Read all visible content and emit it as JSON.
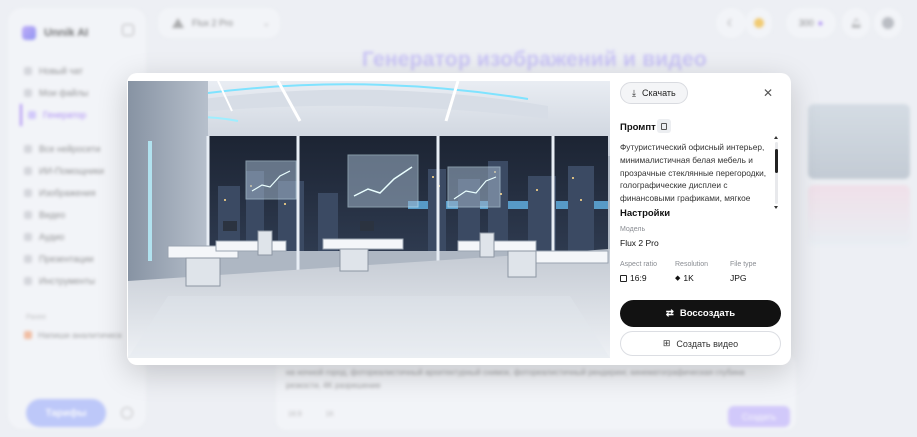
{
  "app": {
    "brand": "Unnik AI",
    "model_pill": "Flux 2 Pro",
    "credits": "300",
    "page_title": "Генератор изображений и видео"
  },
  "sidebar": {
    "items": [
      {
        "label": "Новый чат"
      },
      {
        "label": "Мои файлы"
      },
      {
        "label": "Генератор"
      },
      {
        "label": "Все нейросети"
      },
      {
        "label": "ИИ-Помощники"
      },
      {
        "label": "Изображения"
      },
      {
        "label": "Видео"
      },
      {
        "label": "Аудио"
      },
      {
        "label": "Презентации"
      },
      {
        "label": "Инструменты"
      }
    ],
    "recent_heading": "Ранее",
    "recent_item": "Напиши аналитическ",
    "tariff_button": "Тарифы"
  },
  "background_prompt": {
    "text": "на ночной город, фотореалистичный архитектурный снимок, фотореалистичный рендеринг, кинематографическая глубина резкости, 4K разрешение",
    "chip1": "16:9",
    "chip2": "1К",
    "create_button": "Создать"
  },
  "modal": {
    "download_label": "Скачать",
    "close_icon": "✕",
    "prompt_title": "Промпт",
    "prompt_text": "Футуристический офисный интерьер, минималистичная белая мебель и прозрачные стеклянные перегородки, голографические дисплеи с финансовыми графиками, мягкое",
    "settings_title": "Настройки",
    "model_label": "Модель",
    "model_value": "Flux 2 Pro",
    "aspect_label": "Aspect ratio",
    "aspect_value": "16:9",
    "resolution_label": "Resolution",
    "resolution_value": "1K",
    "filetype_label": "File type",
    "filetype_value": "JPG",
    "remake_label": "Воссоздать",
    "video_label": "Создать видео"
  },
  "colors": {
    "accent": "#8b5cf6",
    "primary_button": "#121212"
  }
}
